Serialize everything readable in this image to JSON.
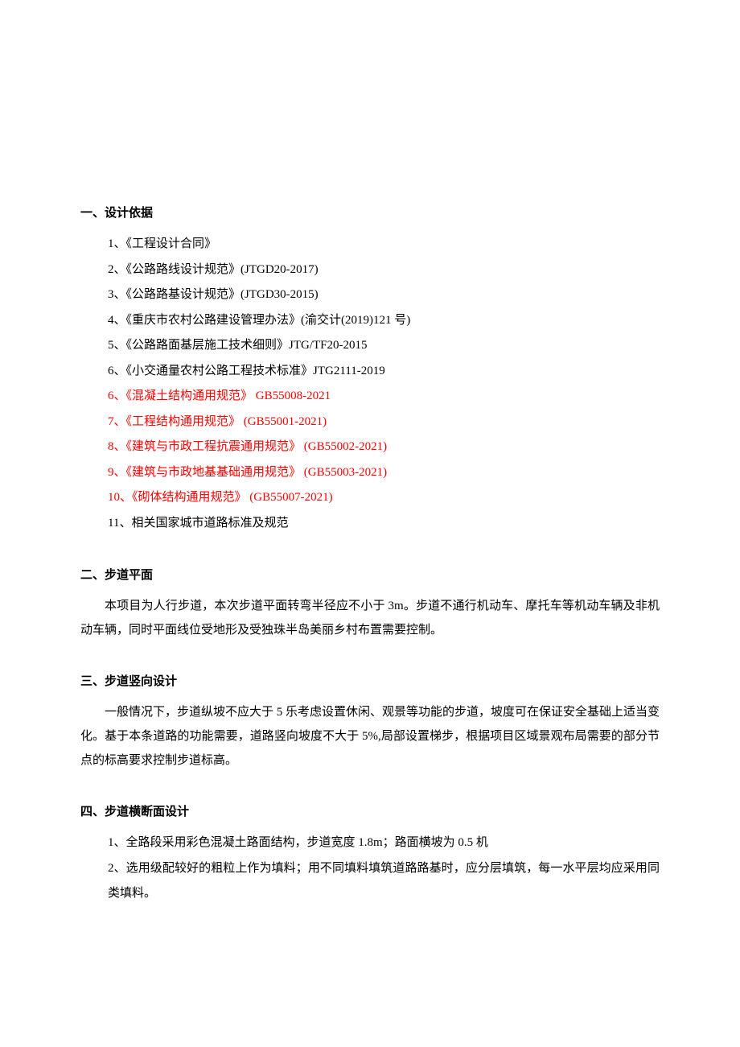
{
  "sections": {
    "s1": {
      "heading": "一、设计依据",
      "items": [
        {
          "text": "1、《工程设计合同》",
          "red": false
        },
        {
          "text": "2、《公路路线设计规范》(JTGD20-2017)",
          "red": false
        },
        {
          "text": "3、《公路路基设计规范》(JTGD30-2015)",
          "red": false
        },
        {
          "text": "4、《重庆市农村公路建设管理办法》(渝交计(2019)121 号)",
          "red": false
        },
        {
          "text": "5、《公路路面基层施工技术细则》JTG/TF20-2015",
          "red": false
        },
        {
          "text": "6、《小交通量农村公路工程技术标准》JTG2111-2019",
          "red": false
        },
        {
          "text": "6、《混凝土结构通用规范》    GB55008-2021",
          "red": true
        },
        {
          "text": "7、《工程结构通用规范》        (GB55001-2021)",
          "red": true
        },
        {
          "text": "8、《建筑与市政工程抗震通用规范》    (GB55002-2021)",
          "red": true
        },
        {
          "text": "9、《建筑与市政地基基础通用规范》    (GB55003-2021)",
          "red": true
        },
        {
          "text": "10、《砌体结构通用规范》          (GB55007-2021)",
          "red": true
        },
        {
          "text": "11、相关国家城市道路标准及规范",
          "red": false
        }
      ]
    },
    "s2": {
      "heading": "二、步道平面",
      "paragraph": "本项目为人行步道，本次步道平面转弯半径应不小于 3m。步道不通行机动车、摩托车等机动车辆及非机动车辆，同时平面线位受地形及受独珠半岛美丽乡村布置需要控制。"
    },
    "s3": {
      "heading": "三、步道竖向设计",
      "paragraph": "一般情况下，步道纵坡不应大于 5 乐考虑设置休闲、观景等功能的步道，坡度可在保证安全基础上适当变化。基于本条道路的功能需要，道路竖向坡度不大于 5%,局部设置梯步，根据项目区域景观布局需要的部分节点的标高要求控制步道标高。"
    },
    "s4": {
      "heading": "四、步道横断面设计",
      "items": [
        {
          "text": "1、全路段采用彩色混凝土路面结构，步道宽度 1.8m；路面横坡为 0.5 机"
        },
        {
          "text": "2、选用级配较好的粗粒上作为填料；用不同填料填筑道路路基时，应分层填筑，每一水平层均应采用同类填料。"
        }
      ]
    }
  }
}
